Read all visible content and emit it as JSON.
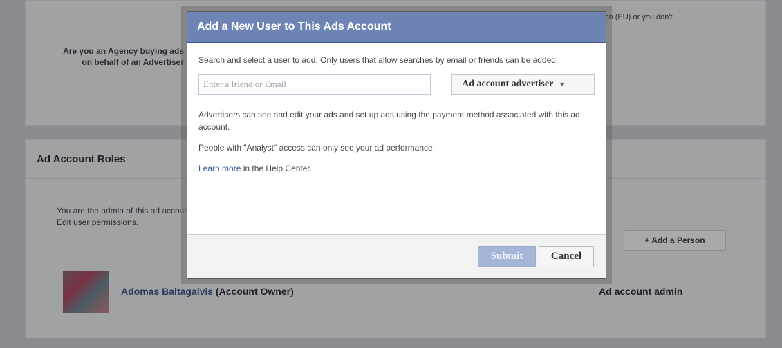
{
  "background": {
    "eu_fragment": "ion (EU) or you don't",
    "agency_question": "Are you an Agency buying ads on behalf of an Advertiser",
    "roles_title": "Ad Account Roles",
    "admin_text": "You are the admin of this ad account. Edit user permissions.",
    "add_person_label": "+ Add a Person",
    "owner_name": "Adomas Baltagalvis",
    "owner_role": "(Account Owner)",
    "admin_role": "Ad account admin"
  },
  "dialog": {
    "title": "Add a New User to This Ads Account",
    "intro": "Search and select a user to add. Only users that allow searches by email or friends can be added.",
    "search_placeholder": "Enter a friend or Email",
    "role_selected": "Ad account advertiser",
    "desc_advertisers": "Advertisers can see and edit your ads and set up ads using the payment method associated with this ad account.",
    "desc_analyst": "People with \"Analyst\" access can only see your ad performance.",
    "learn_more": "Learn more",
    "help_center": " in the Help Center.",
    "submit_label": "Submit",
    "cancel_label": "Cancel"
  },
  "colors": {
    "header_blue": "#6d84b4",
    "link_blue": "#3b5998",
    "submit_disabled": "#a4b5d7"
  },
  "icons": {
    "dropdown": "caret-down-icon"
  }
}
